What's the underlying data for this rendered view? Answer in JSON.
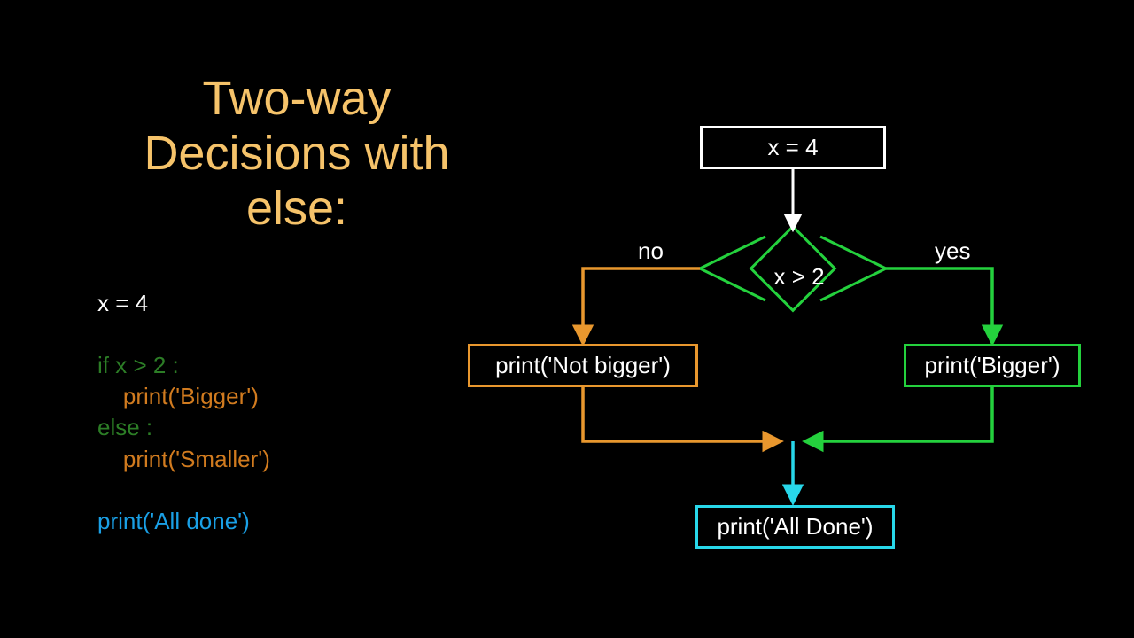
{
  "title": "Two-way Decisions with else:",
  "code": {
    "l1": "x = 4",
    "l2": "if x > 2 :",
    "l3": "    print('Bigger')",
    "l4": "else :",
    "l5": "    print('Smaller')",
    "l6": "print('All done')"
  },
  "flow": {
    "start": "x = 4",
    "condition": "x > 2",
    "no_label": "no",
    "yes_label": "yes",
    "no_branch": "print('Not bigger')",
    "yes_branch": "print('Bigger')",
    "end": "print('All Done')"
  },
  "colors": {
    "title": "#f6c36a",
    "keyword": "#2c7d26",
    "branch": "#d17b1f",
    "final": "#1aa0e6",
    "no_path": "#e8972e",
    "yes_path": "#24d13d",
    "cyan": "#28d7ea"
  }
}
